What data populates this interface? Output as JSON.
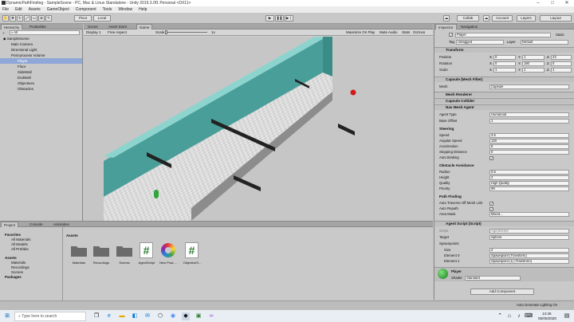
{
  "window": {
    "title": "DynamicPathFinding - SampleScene - PC, Mac & Linux Standalone - Unity 2019.3.0f1 Personal <DX11>"
  },
  "menu": [
    "File",
    "Edit",
    "Assets",
    "GameObject",
    "Component",
    "Tools",
    "Window",
    "Help"
  ],
  "toolbar": {
    "pivot": "Pivot",
    "local": "Local",
    "collab": "Collab",
    "account": "Account",
    "layers": "Layers",
    "layout": "Layout"
  },
  "hierarchy": {
    "tab": "Hierarchy",
    "tab2": "ProBuilder",
    "create": "+",
    "search": "All",
    "items": [
      {
        "label": "SampleScene",
        "depth": 0,
        "selected": false
      },
      {
        "label": "Main Camera",
        "depth": 1
      },
      {
        "label": "Directional Light",
        "depth": 1
      },
      {
        "label": "Post-process Volume",
        "depth": 1
      },
      {
        "label": "Player",
        "depth": 1,
        "selected": true
      },
      {
        "label": "Floor",
        "depth": 1
      },
      {
        "label": "SideWall",
        "depth": 1
      },
      {
        "label": "EndWall",
        "depth": 1
      },
      {
        "label": "Objectives",
        "depth": 1
      },
      {
        "label": "Obstacles",
        "depth": 1
      }
    ]
  },
  "scene": {
    "tabs": [
      "Scene",
      "Asset Store",
      "Game"
    ],
    "display": "Display 1",
    "aspect": "Free Aspect",
    "scale_label": "Scale",
    "scale_value": "1x",
    "maximize": "Maximize On Play",
    "mute": "Mute Audio",
    "stats": "Stats",
    "gizmos": "Gizmos"
  },
  "inspector": {
    "tabs": [
      "Inspector",
      "Navigation"
    ],
    "object_name": "Player",
    "static": "Static",
    "tag_label": "Tag",
    "tag": "Untagged",
    "layer_label": "Layer",
    "layer": "Default",
    "transform": {
      "title": "Transform",
      "position_label": "Position",
      "rotation_label": "Rotation",
      "scale_label": "Scale",
      "position": [
        "0",
        "1",
        "23"
      ],
      "rotation": [
        "0",
        "180",
        "0"
      ],
      "scale": [
        "1",
        "1",
        "1"
      ],
      "axes": [
        "X",
        "Y",
        "Z"
      ]
    },
    "mesh_filter": {
      "title": "Capsule (Mesh Filter)",
      "mesh_label": "Mesh",
      "mesh": "Capsule"
    },
    "mesh_renderer": "Mesh Renderer",
    "capsule_collider": "Capsule Collider",
    "nav": {
      "title": "Nav Mesh Agent",
      "agent_type_label": "Agent Type",
      "agent_type": "Humanoid",
      "base_offset_label": "Base Offset",
      "base_offset": "1",
      "steering": "Steering",
      "speed_label": "Speed",
      "speed": "3.5",
      "angular_label": "Angular Speed",
      "angular": "120",
      "accel_label": "Acceleration",
      "accel": "8",
      "stop_label": "Stopping Distance",
      "stop": "0",
      "braking_label": "Auto Braking",
      "obstacle": "Obstacle Avoidance",
      "radius_label": "Radius",
      "radius": "0.5",
      "height_label": "Height",
      "height": "2",
      "quality_label": "Quality",
      "quality": "High Quality",
      "priority_label": "Priority",
      "priority": "99",
      "path": "Path Finding",
      "traverse_label": "Auto Traverse Off Mesh Link",
      "repath_label": "Auto Repath",
      "area_label": "Area Mask",
      "area": "Mixed..."
    },
    "agent_script": {
      "title": "Agent Script (Script)",
      "script_label": "Script",
      "script": "AgentScript",
      "target_label": "Target",
      "target": "Sphere",
      "spawn_label": "Spawnpoints",
      "size_label": "Size",
      "size": "2",
      "e0_label": "Element 0",
      "e0": "Spawnpoint (Transform)",
      "e1_label": "Element 1",
      "e1": "Spawnpoint (1) (Transform)"
    },
    "material": {
      "name": "Player",
      "shader_label": "Shader",
      "shader": "Standard"
    },
    "add_component": "Add Component"
  },
  "project": {
    "tabs": [
      "Project",
      "Console",
      "Animation"
    ],
    "favorites": "Favorites",
    "fav_items": [
      "All Materials",
      "All Models",
      "All Prefabs"
    ],
    "assets_root": "Assets",
    "assets_children": [
      "Materials",
      "Recordings",
      "Scenes"
    ],
    "packages": "Packages",
    "breadcrumb": "Assets",
    "assets": [
      {
        "label": "Materials",
        "kind": "folder"
      },
      {
        "label": "Recordings",
        "kind": "folder"
      },
      {
        "label": "Scenes",
        "kind": "folder"
      },
      {
        "label": "AgentScript",
        "kind": "script"
      },
      {
        "label": "New Post-...",
        "kind": "profile"
      },
      {
        "label": "ObjectiveS...",
        "kind": "script"
      }
    ]
  },
  "status": {
    "right": "Auto Generate Lighting On"
  },
  "taskbar": {
    "search": "Type here to search",
    "time": "14:45",
    "date": "05/05/2020"
  },
  "colors": {
    "wall": "#4fa6a0",
    "floor": "#e2e2e2",
    "player": "#31a53a",
    "target": "#d11a1a",
    "obstacle": "#2b2b2b"
  }
}
